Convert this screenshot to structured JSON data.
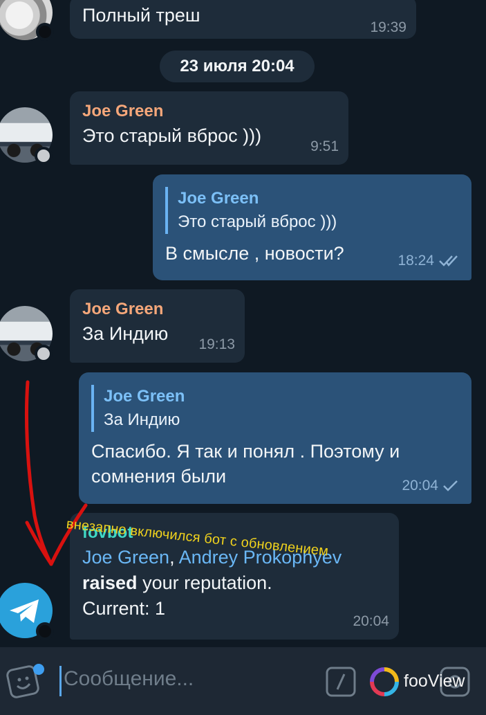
{
  "messages": [
    {
      "text": "Полный треш",
      "time": "19:39"
    },
    {
      "sender": "Joe Green",
      "text": "Это старый вброс )))",
      "time": "9:51"
    },
    {
      "reply_to": {
        "name": "Joe Green",
        "text": "Это старый вброс )))"
      },
      "text": "В смысле  , новости?",
      "time": "18:24"
    },
    {
      "sender": "Joe Green",
      "text": "За Индию",
      "time": "19:13"
    },
    {
      "reply_to": {
        "name": "Joe Green",
        "text": "За Индию"
      },
      "text": "Спасибо. Я так и понял . Поэтому и сомнения были",
      "time": "20:04"
    },
    {
      "sender": "fovbot",
      "mention1": "Joe Green",
      "separator": ", ",
      "mention2": "Andrey Prokophyev",
      "bold": "raised",
      "rest": " your reputation.",
      "line3": "Current: 1",
      "time": "20:04"
    }
  ],
  "date_separator": "23 июля  20:04",
  "annotation": "внезапно включился бот с обновлением",
  "composer": {
    "placeholder": "Сообщение..."
  },
  "brand": "fooView",
  "colors": {
    "background": "#0f1923",
    "incoming": "#1e2c3a",
    "outgoing": "#2b5278",
    "sender": "#f5a77a",
    "bot": "#3fd8c6",
    "link": "#6ab7f5",
    "annotation_red": "#d8110f",
    "annotation_yellow": "#f0d21d"
  },
  "icons": [
    "sticker-icon",
    "slash-command-icon",
    "fooview-logo-icon",
    "attach-icon",
    "telegram-plane-icon",
    "double-check-icon",
    "single-check-icon"
  ]
}
